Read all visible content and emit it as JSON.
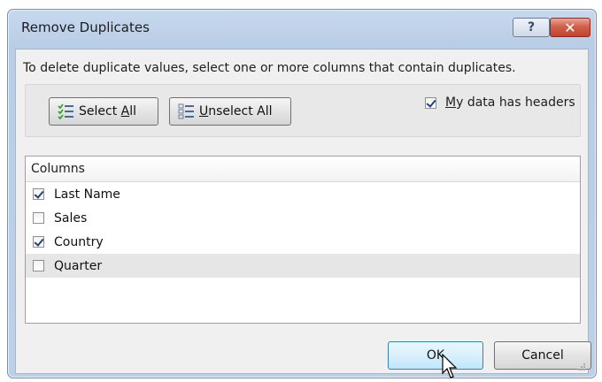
{
  "dialog": {
    "title": "Remove Duplicates",
    "help_glyph": "?",
    "close_glyph": "✕",
    "instruction": "To delete duplicate values, select one or more columns that contain duplicates."
  },
  "toolbar": {
    "select_all": {
      "prefix": "Select ",
      "accel": "A",
      "suffix": "ll"
    },
    "unselect_all": {
      "prefix": "",
      "accel": "U",
      "suffix": "nselect All"
    },
    "headers_checkbox": {
      "prefix": "",
      "accel": "M",
      "suffix": "y data has headers",
      "checked": true
    }
  },
  "columns_list": {
    "header": "Columns",
    "items": [
      {
        "label": "Last Name",
        "checked": true
      },
      {
        "label": "Sales",
        "checked": false
      },
      {
        "label": "Country",
        "checked": true
      },
      {
        "label": "Quarter",
        "checked": false,
        "highlighted": true
      }
    ]
  },
  "buttons": {
    "ok": "OK",
    "cancel": "Cancel"
  },
  "colors": {
    "title_bar": "#c8d9ee",
    "close_button": "#c2432c",
    "ok_border": "#3c7fb1",
    "client_bg": "#f0f0f0"
  }
}
